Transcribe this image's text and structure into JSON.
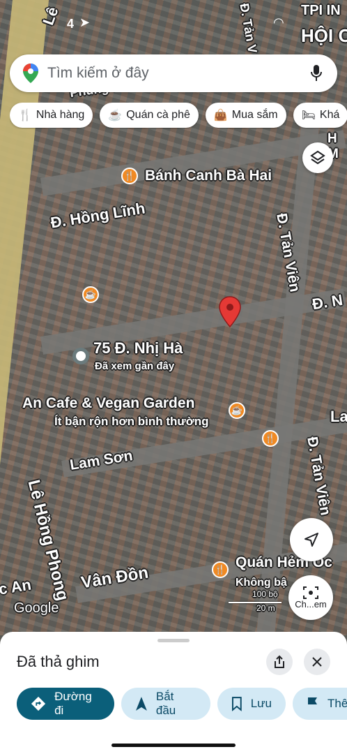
{
  "status": {
    "time_partial": "4",
    "network": "TPI IN"
  },
  "search": {
    "placeholder": "Tìm kiếm ở đây"
  },
  "chips": [
    "Nhà hàng",
    "Quán cà phê",
    "Mua sắm",
    "Khá"
  ],
  "map": {
    "streets": {
      "le_hong_phong_top": "Lê",
      "phung": "Phùng K",
      "tan_v_top": "Đ. Tản V",
      "hoi_c": "HỘI C",
      "hong_linh": "Đ. Hồng Lĩnh",
      "tan_vien_1": "Đ. Tản Viên",
      "d_n": "Đ. N",
      "lam_son": "Lam Sơn",
      "tan_vien_2": "Đ. Tản Viên",
      "la": "La",
      "le_hong_phong": "Lê Hồng Phong",
      "van_don": "Vân Đồn",
      "c_an": "c An",
      "h_m": "H M"
    },
    "places": {
      "banh_canh": "Bánh Canh Bà Hai",
      "address": "75 Đ. Nhị Hà",
      "address_sub": "Đã xem gần đây",
      "an_cafe": "An Cafe & Vegan Garden",
      "an_cafe_sub": "Ít bận rộn hơn bình thường",
      "quan_hem": "Quán Hẻm Ốc",
      "quan_hem_sub": "Không bậ"
    },
    "google": "Google",
    "scale": {
      "ft": "100 bộ",
      "m": "20 m"
    },
    "camera_label": "Ch...em"
  },
  "sheet": {
    "title": "Đã thả ghim",
    "actions": [
      "Đường đi",
      "Bắt đầu",
      "Lưu",
      "Thê"
    ]
  },
  "colors": {
    "accent": "#0b5f7a",
    "pin": "#e53935",
    "poi": "#f08a24"
  }
}
